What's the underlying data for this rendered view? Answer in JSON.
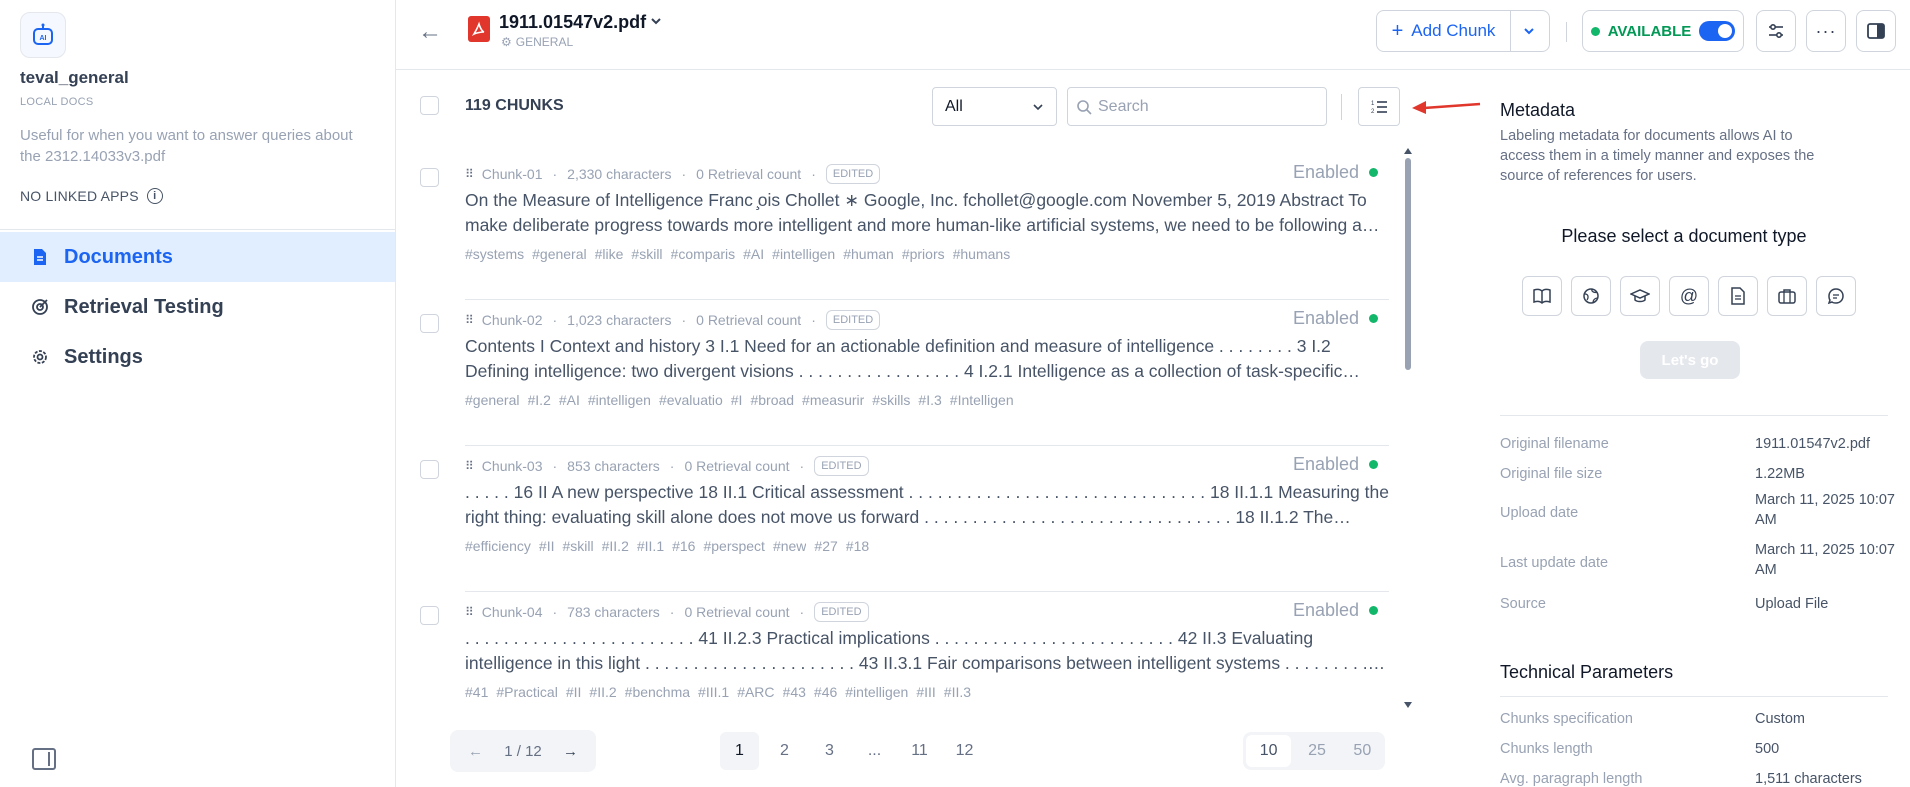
{
  "sidebar": {
    "app_name": "teval_general",
    "app_type": "LOCAL DOCS",
    "description": "Useful for when you want to answer queries about the 2312.14033v3.pdf",
    "linked_apps": "NO LINKED APPS",
    "nav": [
      {
        "label": "Documents",
        "icon": "document-icon",
        "active": true
      },
      {
        "label": "Retrieval Testing",
        "icon": "target-icon",
        "active": false
      },
      {
        "label": "Settings",
        "icon": "gear-icon",
        "active": false
      }
    ]
  },
  "header": {
    "doc_title": "1911.01547v2.pdf",
    "doc_mode": "GENERAL",
    "add_chunk": "Add Chunk",
    "status": "AVAILABLE"
  },
  "toolbar": {
    "chunk_count": "119 CHUNKS",
    "filter_value": "All",
    "search_placeholder": "Search"
  },
  "chunks": [
    {
      "id": "Chunk-01",
      "chars": "2,330 characters",
      "retrieval": "0 Retrieval count",
      "badge": "EDITED",
      "status": "Enabled",
      "content": "On the Measure of Intelligence Franc ̧ois Chollet ∗ Google, Inc. fchollet@google.com November 5, 2019 Abstract To make deliberate progress towards more intelligent and more human-like artificial systems, we need to be following a…",
      "tags": [
        "#systems",
        "#general",
        "#like",
        "#skill",
        "#comparis",
        "#AI",
        "#intelligen",
        "#human",
        "#priors",
        "#humans"
      ]
    },
    {
      "id": "Chunk-02",
      "chars": "1,023 characters",
      "retrieval": "0 Retrieval count",
      "badge": "EDITED",
      "status": "Enabled",
      "content": "Contents I Context and history 3 I.1 Need for an actionable definition and measure of intelligence . . . . . . . . 3 I.2 Defining intelligence: two divergent visions . . . . . . . . . . . . . . . . . 4 I.2.1 Intelligence as a collection of task-specific skill…",
      "tags": [
        "#general",
        "#I.2",
        "#AI",
        "#intelligen",
        "#evaluatio",
        "#I",
        "#broad",
        "#measurir",
        "#skills",
        "#I.3",
        "#Intelligen"
      ]
    },
    {
      "id": "Chunk-03",
      "chars": "853 characters",
      "retrieval": "0 Retrieval count",
      "badge": "EDITED",
      "status": "Enabled",
      "content": ". . . . . 16 II A new perspective 18 II.1 Critical assessment . . . . . . . . . . . . . . . . . . . . . . . . . . . . . . . 18 II.1.1 Measuring the right thing: evaluating skill alone does not move us forward . . . . . . . . . . . . . . . . . . . . . . . . . . . . . . . . 18 II.1.2 The…",
      "tags": [
        "#efficiency",
        "#II",
        "#skill",
        "#II.2",
        "#II.1",
        "#16",
        "#perspect",
        "#new",
        "#27",
        "#18"
      ]
    },
    {
      "id": "Chunk-04",
      "chars": "783 characters",
      "retrieval": "0 Retrieval count",
      "badge": "EDITED",
      "status": "Enabled",
      "content": ". . . . . . . . . . . . . . . . . . . . . . . . 41 II.2.3 Practical implications . . . . . . . . . . . . . . . . . . . . . . . . . 42 II.3 Evaluating intelligence in this light . . . . . . . . . . . . . . . . . . . . . . 43 II.3.1 Fair comparisons between intelligent systems . . . . . . . . . . . . . . 43 II.3.2…",
      "tags": [
        "#41",
        "#Practical",
        "#II",
        "#II.2",
        "#benchma",
        "#III.1",
        "#ARC",
        "#43",
        "#46",
        "#intelligen",
        "#III",
        "#II.3"
      ]
    }
  ],
  "pagination": {
    "page_indicator": "1 / 12",
    "pages": [
      "1",
      "2",
      "3",
      "...",
      "11",
      "12"
    ],
    "sizes": [
      "10",
      "25",
      "50"
    ]
  },
  "metadata_panel": {
    "title": "Metadata",
    "description": "Labeling metadata for documents allows AI to access them in a timely manner and exposes the source of references for users.",
    "select_prompt": "Please select a document type",
    "type_icons": [
      "book-icon",
      "globe-icon",
      "graduation-cap-icon",
      "at-icon",
      "file-icon",
      "briefcase-icon",
      "chat-icon"
    ],
    "lets_go": "Let's go",
    "fields": [
      {
        "label": "Original filename",
        "value": "1911.01547v2.pdf"
      },
      {
        "label": "Original file size",
        "value": "1.22MB"
      },
      {
        "label": "Upload date",
        "value": "March 11, 2025 10:07 AM"
      },
      {
        "label": "Last update date",
        "value": "March 11, 2025 10:07 AM"
      },
      {
        "label": "Source",
        "value": "Upload File"
      }
    ],
    "tech_title": "Technical Parameters",
    "tech_fields": [
      {
        "label": "Chunks specification",
        "value": "Custom"
      },
      {
        "label": "Chunks length",
        "value": "500"
      },
      {
        "label": "Avg. paragraph length",
        "value": "1,511 characters"
      }
    ]
  },
  "colors": {
    "accent": "#1c64f2",
    "available": "#039855",
    "annotation_arrow": "#e0362c"
  }
}
